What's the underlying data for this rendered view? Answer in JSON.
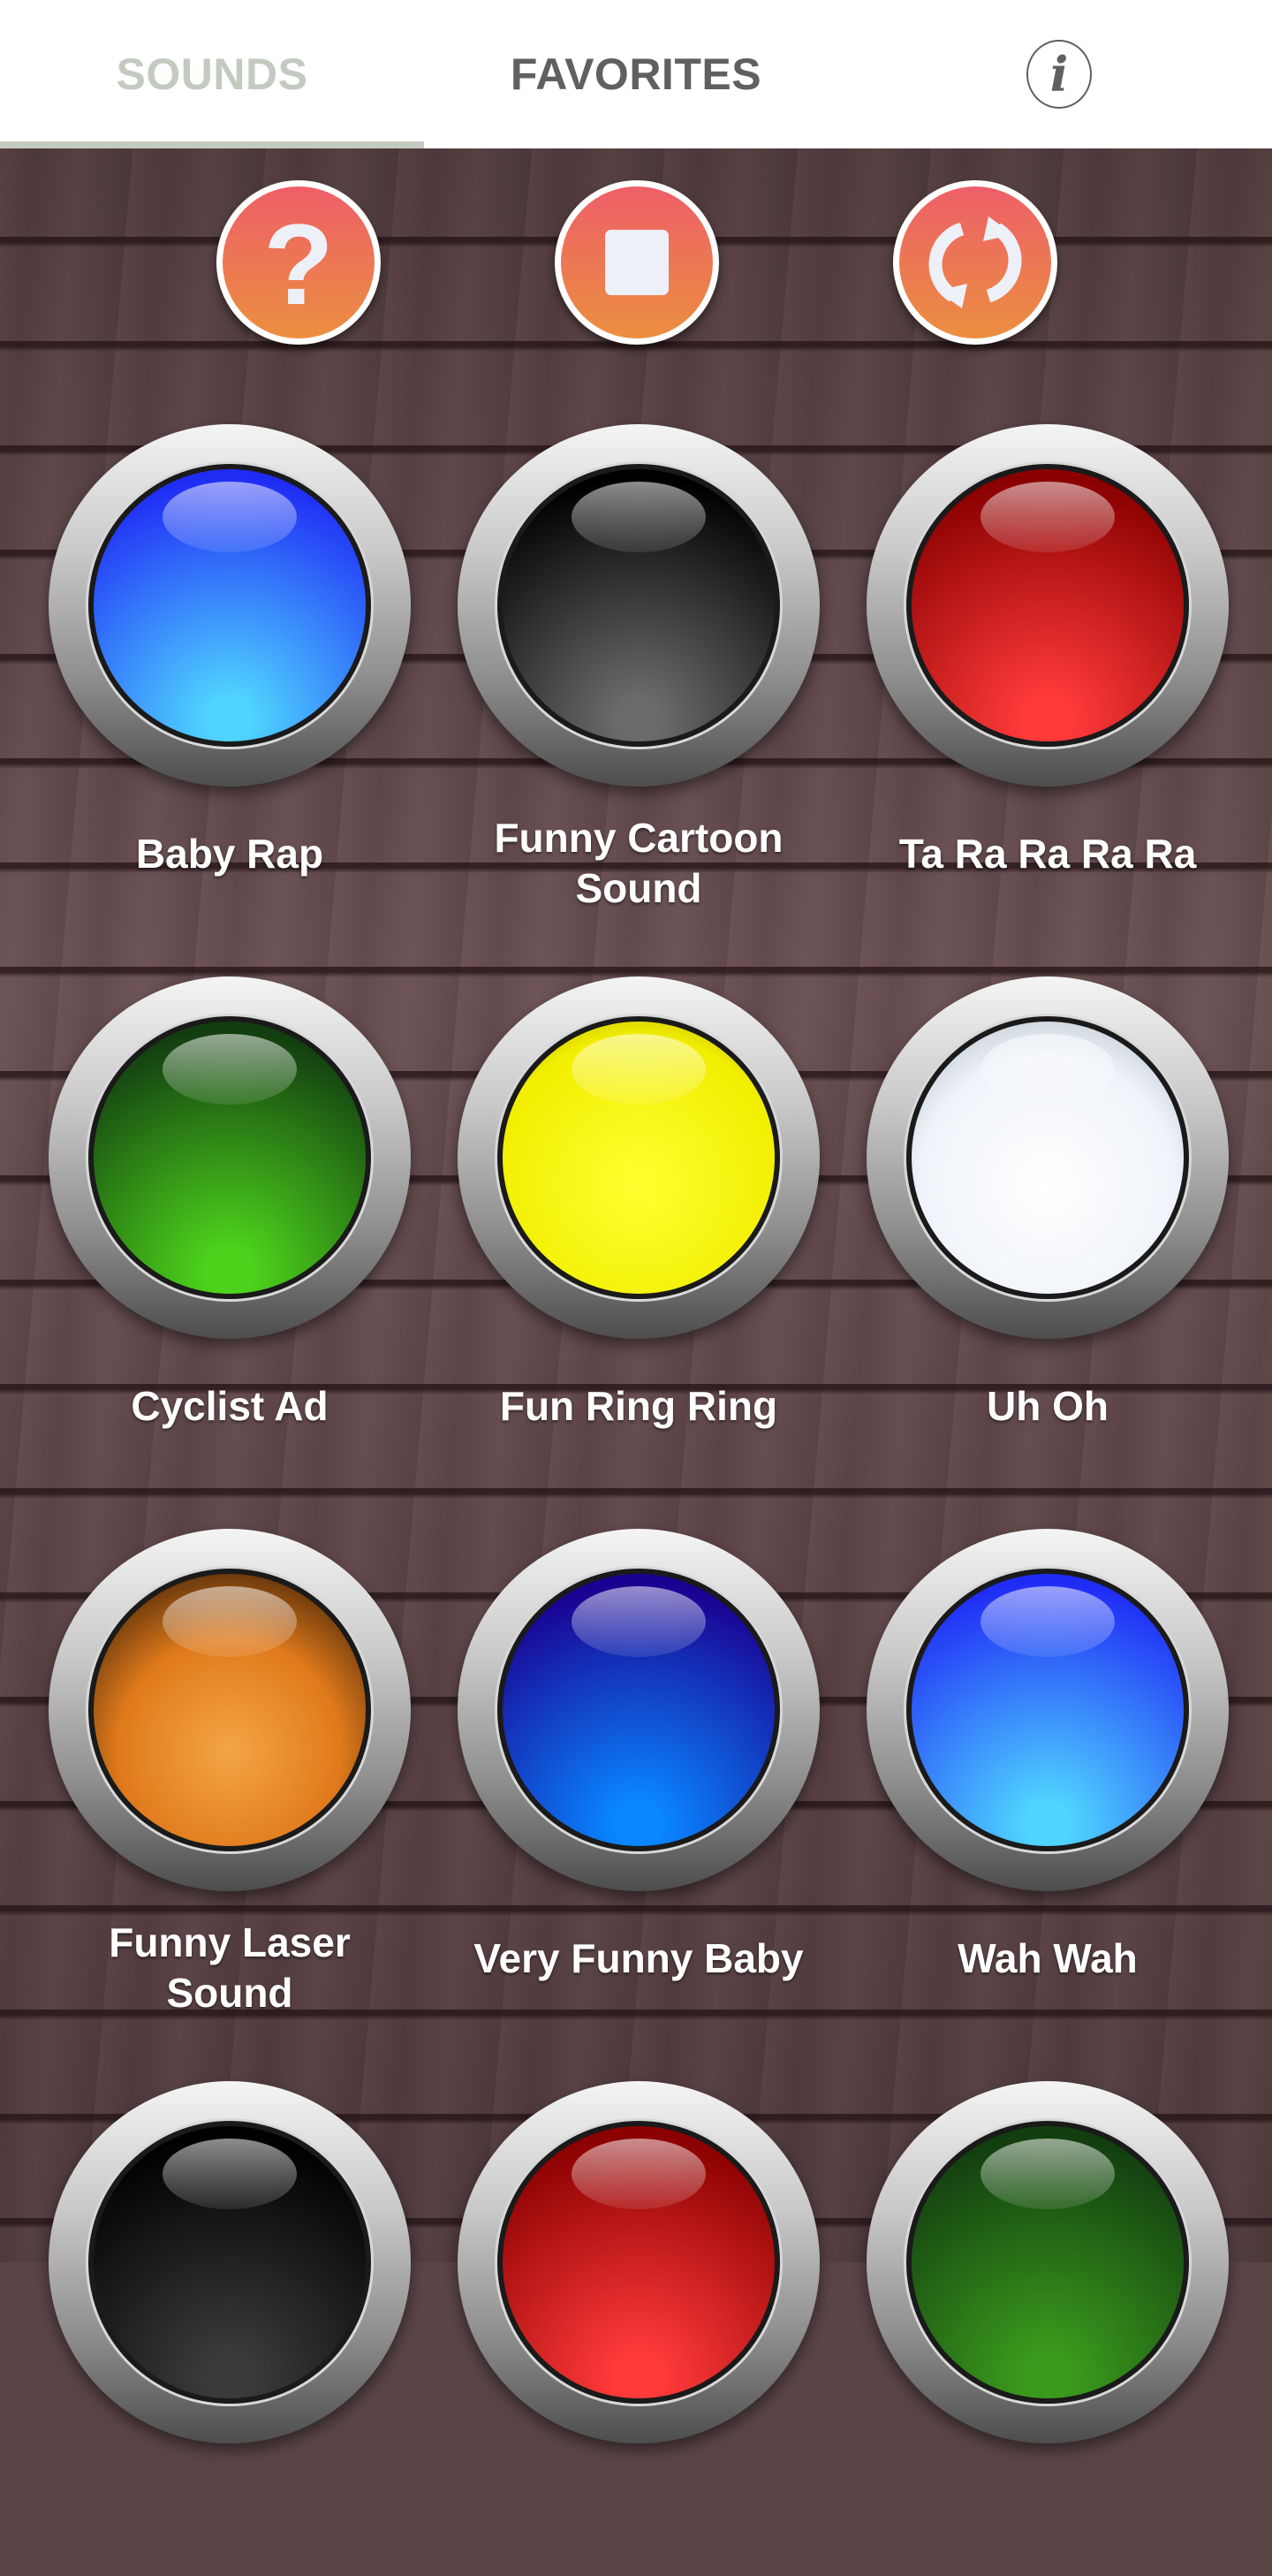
{
  "tabs": [
    {
      "label": "SOUNDS",
      "active": true
    },
    {
      "label": "FAVORITES",
      "active": false
    }
  ],
  "header": {
    "info_icon": "info-icon",
    "info_glyph": "i",
    "active_color": "#c3cbc0",
    "inactive_color": "#606060"
  },
  "controls": [
    {
      "name": "help",
      "icon": "question-icon",
      "glyph": "?"
    },
    {
      "name": "stop",
      "icon": "stop-icon"
    },
    {
      "name": "refresh",
      "icon": "refresh-icon"
    }
  ],
  "control_gradient": [
    "#ee5f68",
    "#ec8e40"
  ],
  "sounds": [
    {
      "label": "Baby Rap",
      "color": "blue",
      "top": "#1f2cf5",
      "bottom": "#4fd3ff"
    },
    {
      "label": "Funny Cartoon Sound",
      "color": "black",
      "top": "#000000",
      "bottom": "#6a6a6a"
    },
    {
      "label": "Ta Ra Ra Ra Ra",
      "color": "red",
      "top": "#8a0000",
      "bottom": "#ff3a3a"
    },
    {
      "label": "Cyclist Ad",
      "color": "green",
      "top": "#123d10",
      "bottom": "#4dd31c"
    },
    {
      "label": "Fun Ring Ring",
      "color": "yellow",
      "top": "#f4f000",
      "bottom": "#ffff20"
    },
    {
      "label": "Uh Oh",
      "color": "white",
      "top": "#ffffff",
      "bottom": "#dfe7f2"
    },
    {
      "label": "Funny Laser Sound",
      "color": "orange",
      "top": "#3a1a00",
      "bottom": "#f3a546"
    },
    {
      "label": "Very Funny Baby",
      "color": "indigo",
      "top": "#1a0090",
      "bottom": "#0a86ff"
    },
    {
      "label": "Wah Wah",
      "color": "blue",
      "top": "#1f2cf5",
      "bottom": "#4fd3ff"
    },
    {
      "label": "",
      "color": "black",
      "top": "#000000",
      "bottom": "#3a3a3a"
    },
    {
      "label": "",
      "color": "red",
      "top": "#8a0000",
      "bottom": "#ff3a3a"
    },
    {
      "label": "",
      "color": "green",
      "top": "#123d10",
      "bottom": "#3a9a1c"
    }
  ]
}
